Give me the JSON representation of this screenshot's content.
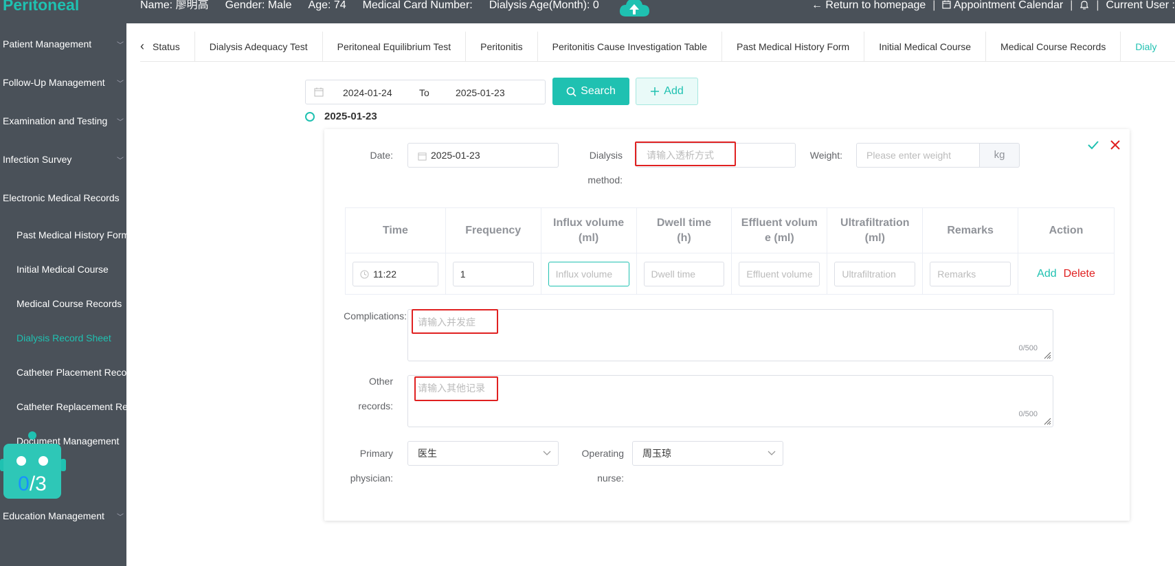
{
  "header": {
    "brand": "Peritoneal",
    "name": "Name: 廖明高",
    "gender": "Gender: Male",
    "age": "Age: 74",
    "medical_card": "Medical Card Number:",
    "dialysis_age": "Dialysis Age(Month): 0",
    "return_home": "Return to homepage",
    "appointment": "Appointment Calendar",
    "current_user": "Current User :",
    "separator": "|"
  },
  "sidebar": {
    "items": [
      {
        "label": "Patient Management"
      },
      {
        "label": "Follow-Up Management"
      },
      {
        "label": "Examination and Testing"
      },
      {
        "label": "Infection Survey"
      },
      {
        "label": "Electronic Medical Records"
      }
    ],
    "subitems": [
      {
        "label": "Past Medical History Form"
      },
      {
        "label": "Initial Medical Course"
      },
      {
        "label": "Medical Course Records"
      },
      {
        "label": "Dialysis Record Sheet"
      },
      {
        "label": "Catheter Placement Record"
      },
      {
        "label": "Catheter Replacement Record"
      }
    ],
    "document_management": "Document Management",
    "education_management": "Education Management"
  },
  "robot": {
    "count": "0",
    "total": "/3"
  },
  "tabs": [
    {
      "label": "Status"
    },
    {
      "label": "Dialysis Adequacy Test"
    },
    {
      "label": "Peritoneal Equilibrium Test"
    },
    {
      "label": "Peritonitis"
    },
    {
      "label": "Peritonitis Cause Investigation Table"
    },
    {
      "label": "Past Medical History Form"
    },
    {
      "label": "Initial Medical Course"
    },
    {
      "label": "Medical Course Records"
    },
    {
      "label": "Dialy"
    }
  ],
  "filter": {
    "start_date": "2024-01-24",
    "to": "To",
    "end_date": "2025-01-23",
    "search": "Search",
    "add": "Add"
  },
  "record": {
    "timeline_date": "2025-01-23",
    "date_label": "Date:",
    "date_value": "2025-01-23",
    "method_label_1": "Dialysis",
    "method_label_2": "method:",
    "method_placeholder": "请输入透析方式",
    "weight_label": "Weight:",
    "weight_placeholder": "Please enter weight",
    "weight_unit": "kg",
    "table": {
      "headers": [
        [
          "Time"
        ],
        [
          "Frequency"
        ],
        [
          "Influx volume",
          "(ml)"
        ],
        [
          "Dwell time",
          "(h)"
        ],
        [
          "Effluent volum",
          "e  (ml)"
        ],
        [
          "Ultrafiltration",
          "(ml)"
        ],
        [
          "Remarks"
        ],
        [
          "Action"
        ]
      ],
      "row": {
        "time": "11:22",
        "frequency": "1",
        "influx_placeholder": "Influx volume",
        "dwell_placeholder": "Dwell time",
        "effluent_placeholder": "Effluent volume",
        "ultra_placeholder": "Ultrafiltration",
        "remarks_placeholder": "Remarks",
        "add": "Add",
        "delete": "Delete"
      }
    },
    "complications_label": "Complications:",
    "complications_placeholder": "请输入并发症",
    "complications_count": "0/500",
    "other_label_1": "Other",
    "other_label_2": "records:",
    "other_placeholder": "请输入其他记录",
    "other_count": "0/500",
    "physician_label_1": "Primary",
    "physician_label_2": "physician:",
    "physician_value": "医生",
    "nurse_label_1": "Operating",
    "nurse_label_2": "nurse:",
    "nurse_value": "周玉琼"
  },
  "colors": {
    "accent": "#1fc1b1",
    "danger": "#e02020",
    "sidebar": "#4a5159"
  }
}
